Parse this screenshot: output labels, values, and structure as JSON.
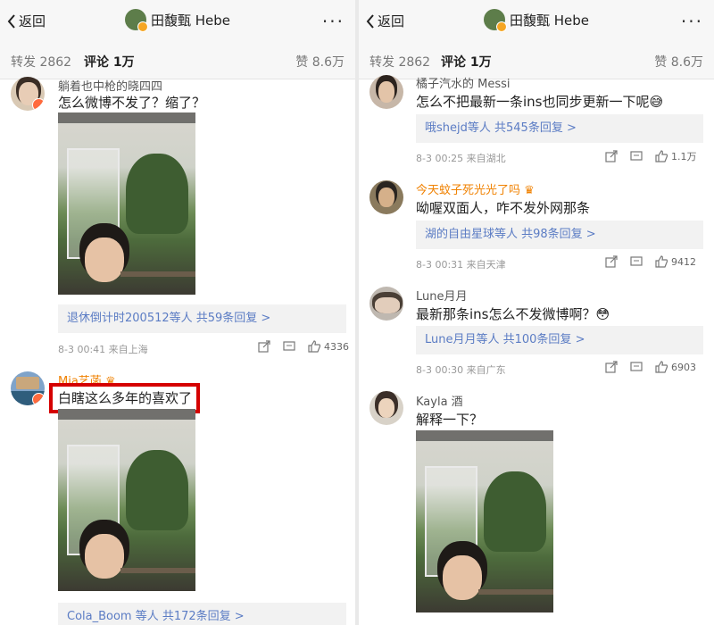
{
  "left": {
    "header": {
      "back": "返回",
      "title": "田馥甄 Hebe"
    },
    "tabs": {
      "repost": "转发 2862",
      "comment": "评论 1万",
      "likes": "赞 8.6万"
    },
    "comments": [
      {
        "name": "躺着也中枪的晓四四",
        "text": "怎么微博不发了？缩了？",
        "reply": "退休倒计时200512等人 共59条回复 >",
        "meta": "8-3 00:41 来自上海",
        "likes": "4336"
      },
      {
        "name": "Mia艺菡",
        "text": "白瞎这么多年的喜欢了",
        "reply": "Cola_Boom 等人 共172条回复 >"
      }
    ]
  },
  "right": {
    "header": {
      "back": "返回",
      "title": "田馥甄 Hebe"
    },
    "tabs": {
      "repost": "转发 2862",
      "comment": "评论 1万",
      "likes": "赞 8.6万"
    },
    "comments": [
      {
        "name": "橘子汽水的 Messi",
        "text": "怎么不把最新一条ins也同步更新一下呢😅",
        "reply": "哦shejd等人 共545条回复 >",
        "meta": "8-3 00:25 来自湖北",
        "likes": "1.1万"
      },
      {
        "name": "今天蚊子死光光了吗",
        "text": "呦喔双面人，咋不发外网那条",
        "reply": "湖的自由星球等人 共98条回复 >",
        "meta": "8-3 00:31 来自天津",
        "likes": "9412"
      },
      {
        "name": "Lune月月",
        "text": "最新那条ins怎么不发微博啊？😳",
        "reply": "Lune月月等人 共100条回复 >",
        "meta": "8-3 00:30 来自广东",
        "likes": "6903"
      },
      {
        "name": "Kayla 酒",
        "text": "解释一下？"
      }
    ]
  }
}
